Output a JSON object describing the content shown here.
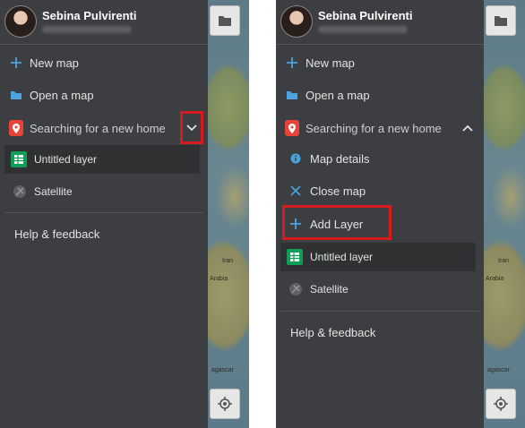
{
  "left": {
    "user": {
      "name": "Sebina Pulvirenti"
    },
    "menu": {
      "new_map": "New map",
      "open_map": "Open a map",
      "current_map": "Searching for a new home"
    },
    "layers": [
      {
        "label": "Untitled layer",
        "icon": "spreadsheet-icon"
      },
      {
        "label": "Satellite",
        "icon": "satellite-icon"
      }
    ],
    "help": "Help & feedback"
  },
  "right": {
    "user": {
      "name": "Sebina Pulvirenti"
    },
    "menu": {
      "new_map": "New map",
      "open_map": "Open a map",
      "current_map": "Searching for a new home",
      "map_details": "Map details",
      "close_map": "Close map",
      "add_layer": "Add Layer"
    },
    "layers": [
      {
        "label": "Untitled layer",
        "icon": "spreadsheet-icon"
      },
      {
        "label": "Satellite",
        "icon": "satellite-icon"
      }
    ],
    "help": "Help & feedback"
  },
  "map": {
    "labels": [
      "Iran",
      "Arabia",
      "agascar"
    ]
  },
  "colors": {
    "drawer_bg": "#3c3e41",
    "highlight_red": "#d71920",
    "plus_blue": "#4aa3df",
    "pin_red": "#e84336",
    "sheet_green": "#0f9d58"
  }
}
